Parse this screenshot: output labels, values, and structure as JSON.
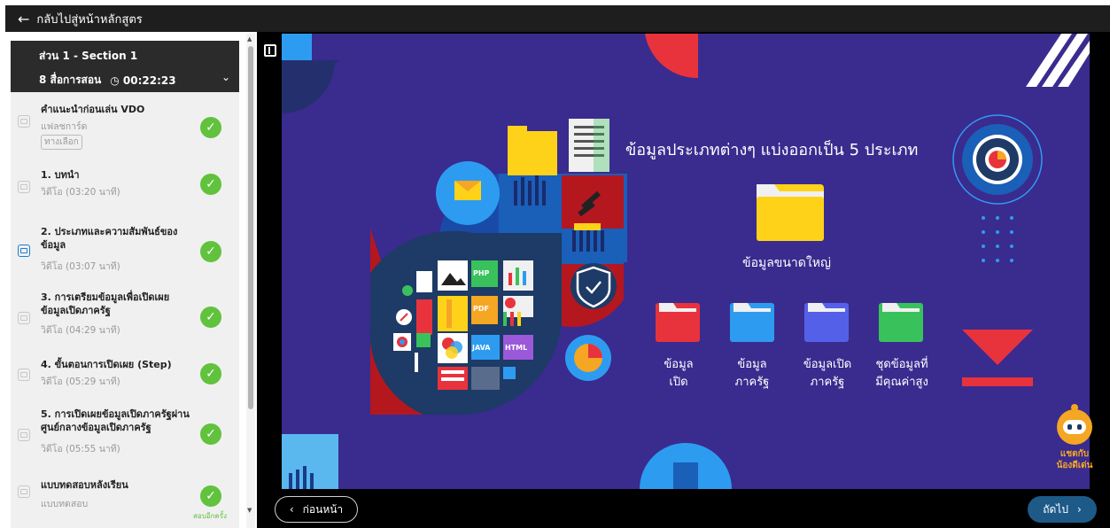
{
  "topbar": {
    "back_label": "กลับไปสู่หน้าหลักสูตร"
  },
  "section": {
    "title": "ส่วน 1 - Section 1",
    "count": "8 สื่อการสอน",
    "duration": "00:22:23"
  },
  "items": [
    {
      "title": "คำแนะนำก่อนเล่น VDO",
      "sub": "แฟลชการ์ด",
      "tag": "ทางเลือก"
    },
    {
      "title": "1. บทนำ",
      "sub": "วิดีโอ (03:20 นาที)"
    },
    {
      "title": "2. ประเภทและความสัมพันธ์ของข้อมูล",
      "sub": "วิดีโอ (03:07 นาที)"
    },
    {
      "title": "3. การเตรียมข้อมูลเพื่อเปิดเผยข้อมูลเปิดภาครัฐ",
      "sub": "วิดีโอ (04:29 นาที)"
    },
    {
      "title": "4. ขั้นตอนการเปิดเผย (Step)",
      "sub": "วิดีโอ (05:29 นาที)"
    },
    {
      "title": "5. การเปิดเผยข้อมูลเปิดภาครัฐผ่านศูนย์กลางข้อมูลเปิดภาครัฐ",
      "sub": "วิดีโอ (05:55 นาที)"
    },
    {
      "title": "แบบทดสอบหลังเรียน",
      "sub": "แบบทดสอบ",
      "retry": "สอบอีกครั้ง"
    }
  ],
  "slide": {
    "heading": "ข้อมูลประเภทต่างๆ แบ่งออกเป็น 5 ประเภท",
    "big_label": "ข้อมูลขนาดใหญ่",
    "folders": [
      {
        "l1": "ข้อมูล",
        "l2": "เปิด",
        "color": "#e8333c"
      },
      {
        "l1": "ข้อมูล",
        "l2": "ภาครัฐ",
        "color": "#2d9cf0"
      },
      {
        "l1": "ข้อมูลเปิด",
        "l2": "ภาครัฐ",
        "color": "#5560e8"
      },
      {
        "l1": "ชุดข้อมูลที่",
        "l2": "มีคุณค่าสูง",
        "color": "#39c25c"
      }
    ],
    "file_icons": [
      "PHP",
      "PDF",
      "JAVA",
      "HTML"
    ]
  },
  "nav": {
    "prev_label": "ก่อนหน้า",
    "next_label": "ถัดไป"
  },
  "mascot": {
    "line1": "แชตกับ",
    "line2": "น้องดีเด่น"
  },
  "colors": {
    "check": "#61c23d",
    "slide_bg": "#3a2b8f",
    "next_btn": "#1e5a88",
    "mascot_text": "#f5a623"
  }
}
